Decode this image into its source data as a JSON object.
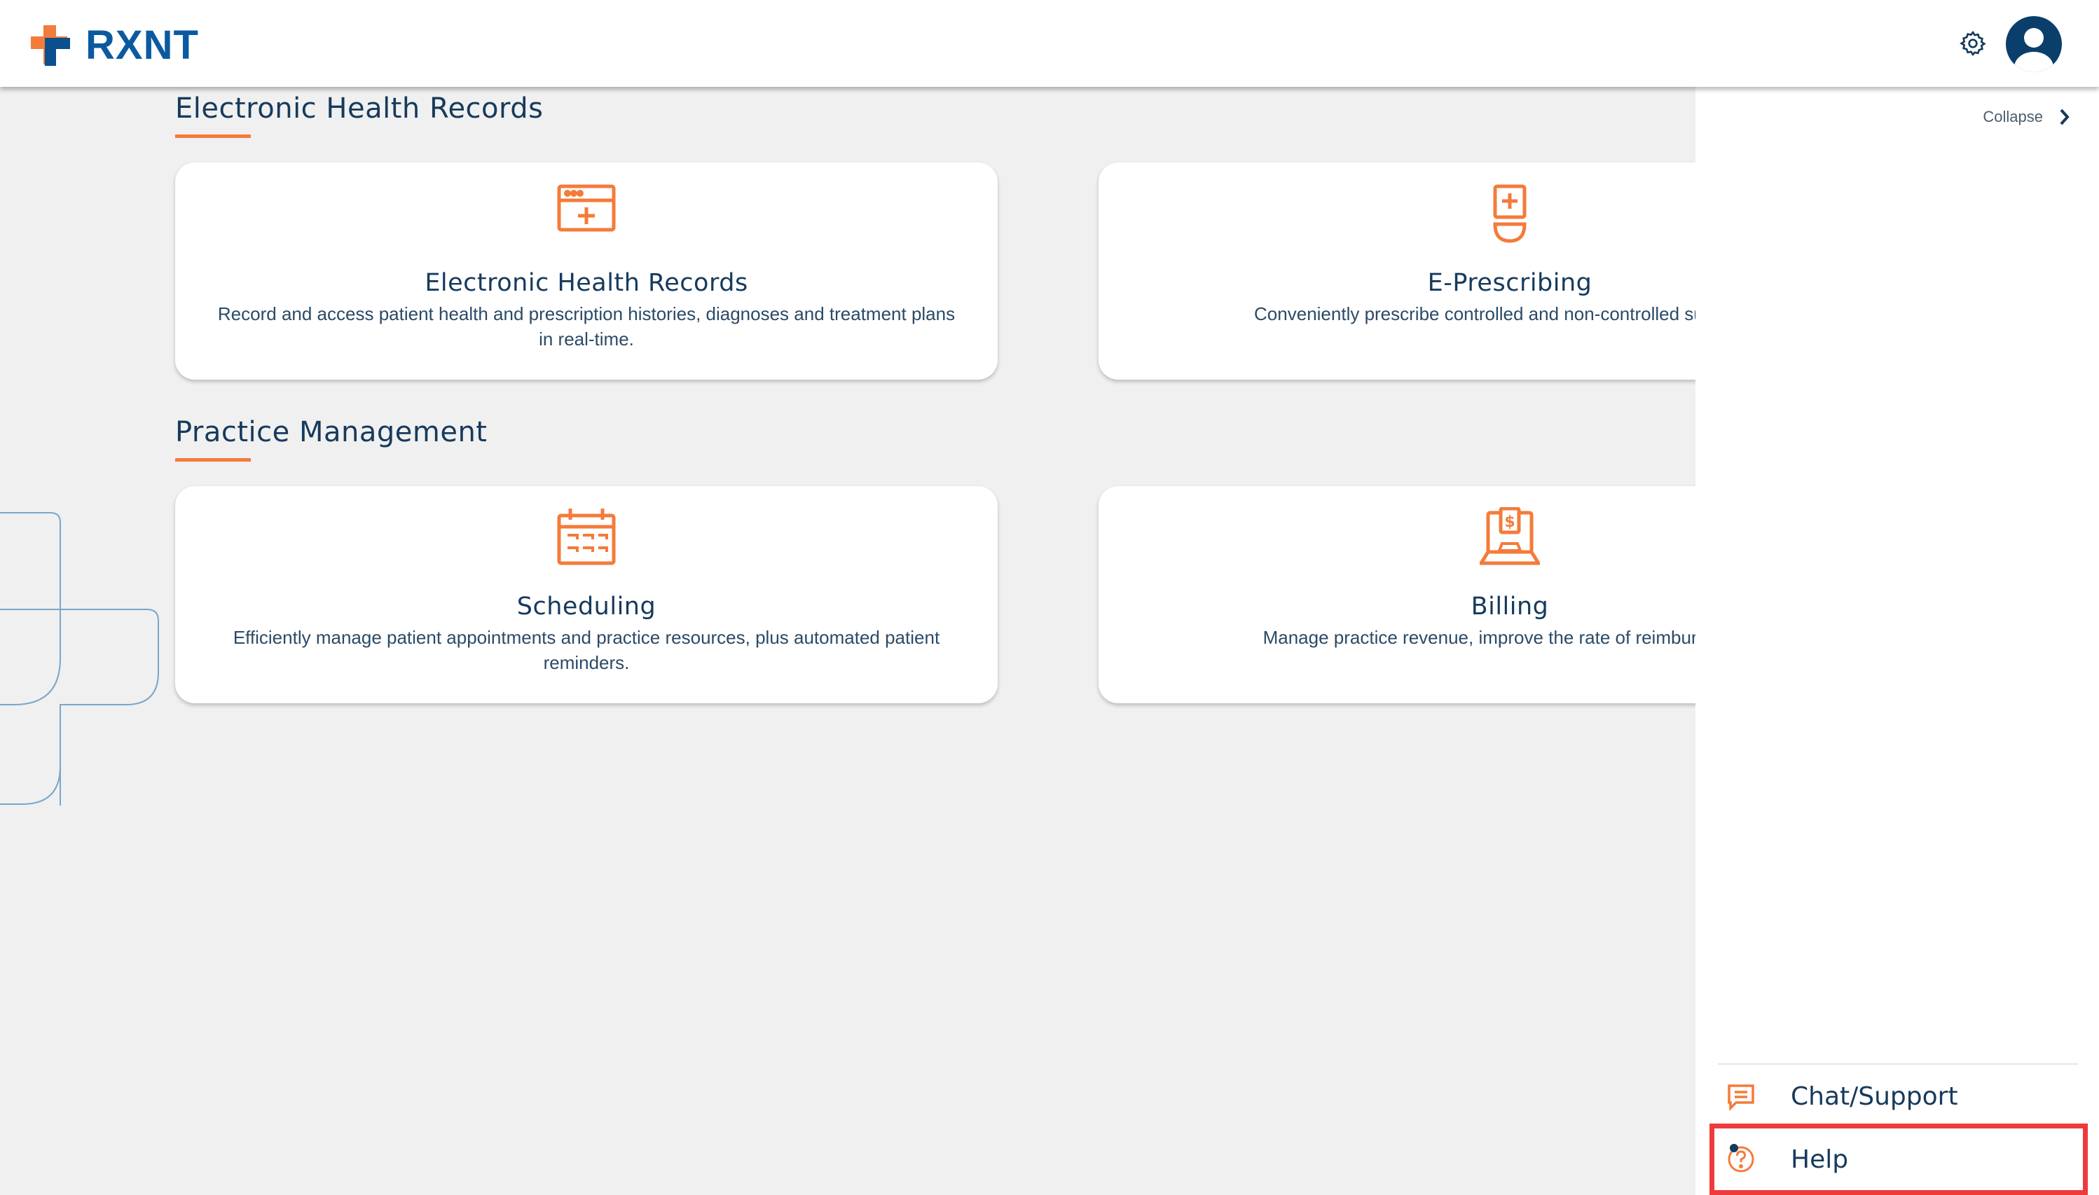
{
  "header": {
    "logo_text": "RXNT",
    "settings_icon": "gear-icon",
    "avatar_icon": "user-avatar-icon"
  },
  "sections": [
    {
      "title": "Electronic Health Records",
      "cards": [
        {
          "icon": "ehr-window-plus-icon",
          "title": "Electronic Health Records",
          "description": "Record and access patient health and prescription histories, diagnoses and treatment plans in real-time."
        },
        {
          "icon": "prescription-bottle-icon",
          "title": "E-Prescribing",
          "description": "Conveniently prescribe controlled and non-controlled substanc at any time."
        }
      ]
    },
    {
      "title": "Practice Management",
      "cards": [
        {
          "icon": "calendar-icon",
          "title": "Scheduling",
          "description": "Efficiently manage patient appointments and practice resources, plus automated patient reminders."
        },
        {
          "icon": "laptop-billing-icon",
          "title": "Billing",
          "description": "Manage practice revenue, improve the rate of reimbursemen profitability."
        }
      ]
    }
  ],
  "sidebar": {
    "collapse_label": "Collapse",
    "items": [
      {
        "label": "Chat/Support",
        "icon": "chat-icon"
      },
      {
        "label": "Help",
        "icon": "help-icon"
      }
    ]
  },
  "colors": {
    "accent": "#f47b3a",
    "navy": "#163a5c",
    "brand_blue": "#0b5aa0",
    "highlight": "#ee3a3a"
  }
}
